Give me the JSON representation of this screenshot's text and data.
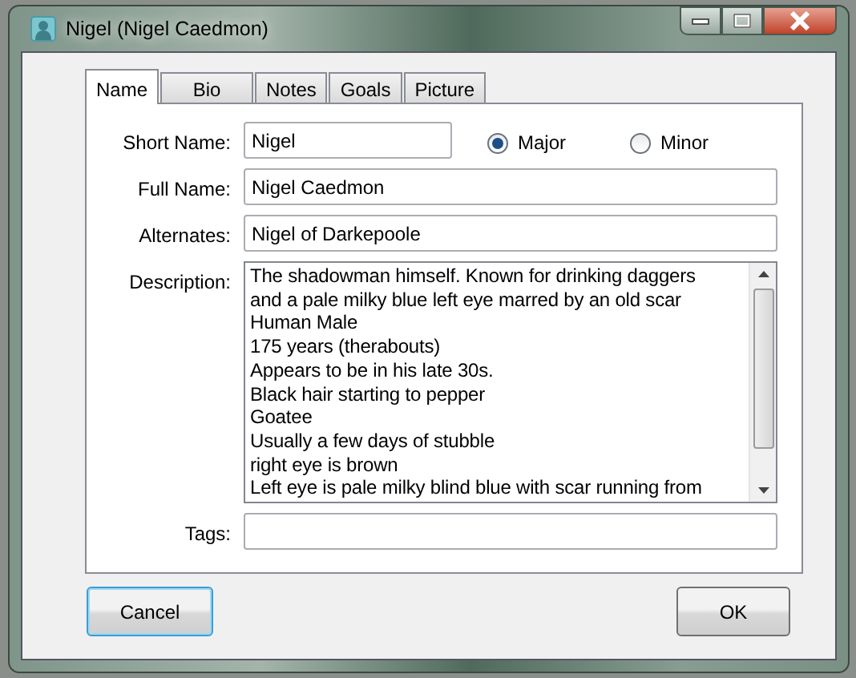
{
  "window": {
    "title": "Nigel (Nigel Caedmon)"
  },
  "tabs": [
    {
      "label": "Name",
      "selected": true
    },
    {
      "label": "Bio",
      "selected": false
    },
    {
      "label": "Notes",
      "selected": false
    },
    {
      "label": "Goals",
      "selected": false
    },
    {
      "label": "Picture",
      "selected": false
    }
  ],
  "short_name": {
    "label": "Short Name:",
    "value": "Nigel"
  },
  "radios": [
    {
      "label": "Major",
      "selected": true
    },
    {
      "label": "Minor",
      "selected": false
    }
  ],
  "fields": [
    {
      "label": "Full Name:",
      "value": "Nigel Caedmon"
    },
    {
      "label": "Alternates:",
      "value": "Nigel of Darkepoole"
    }
  ],
  "description": {
    "label": "Description:",
    "lines": [
      "The shadowman himself. Known for drinking daggers",
      "and a pale milky blue left eye marred by an old scar",
      "Human Male",
      "175 years (therabouts)",
      "Appears to be in his late 30s.",
      "Black hair starting to pepper",
      "Goatee",
      "Usually a few days of stubble",
      "right eye is brown",
      "Left eye is pale milky blind blue with scar running from"
    ]
  },
  "tags": {
    "label": "Tags:"
  },
  "buttons": [
    {
      "label": "Cancel",
      "focused": true
    },
    {
      "label": "OK",
      "focused": false
    }
  ]
}
